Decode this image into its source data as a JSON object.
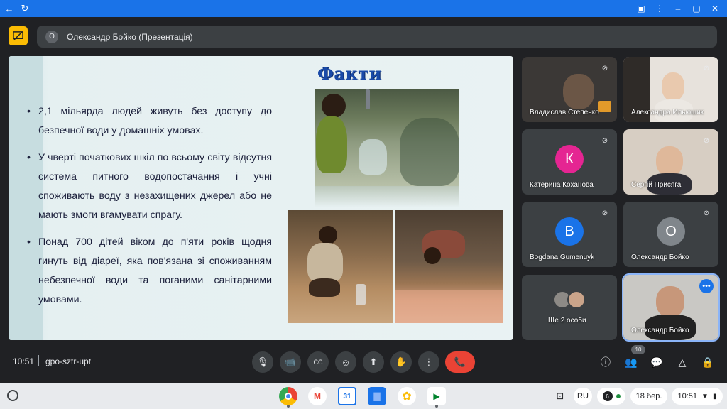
{
  "browser": {
    "back_icon": "←",
    "reload_icon": "↻",
    "right_icons": [
      "▣",
      "⋮",
      "–",
      "▢",
      "✕"
    ]
  },
  "presenter": {
    "avatar_letter": "О",
    "name": "Олександр Бойко (Презентація)"
  },
  "slide": {
    "title": "Факти",
    "bullets": [
      "2,1 мільярда людей живуть без доступу до безпечної води у домашніх умовах.",
      "У чверті початкових шкіл по всьому світу відсутня система питного водопостачання і учні споживають воду з незахищених джерел або не мають змоги вгамувати спрагу.",
      "Понад 700 дітей віком до п'яти років щодня гинуть від діареї, яка пов'язана зі споживанням небезпечної води та поганими санітарними умовами."
    ]
  },
  "participants": [
    {
      "name": "Владислав Степенко"
    },
    {
      "name": "Александра Ильюшик"
    },
    {
      "name": "Катерина Коханова",
      "letter": "К",
      "color": "#e52592"
    },
    {
      "name": "Сергій Присяга"
    },
    {
      "name": "Bogdana Gumenuyk",
      "letter": "B",
      "color": "#1a73e8"
    },
    {
      "name": "Олександр Бойко",
      "letter": "О",
      "color": "#80868b"
    },
    {
      "name": "Ще 2 особи"
    },
    {
      "name": "Олександр Бойко"
    }
  ],
  "meeting": {
    "time": "10:51",
    "code": "gpo-sztr-upt",
    "participant_count": "10"
  },
  "controls": {
    "mic": "🎙",
    "camera": "📹",
    "captions": "CC",
    "emoji": "☺",
    "present": "⬆",
    "hand": "✋",
    "more": "⋮",
    "end": "📞",
    "info": "ⓘ",
    "people": "👥",
    "chat": "💬",
    "activities": "△",
    "host": "🔒"
  },
  "shelf": {
    "lang": "RU",
    "notifications": "6",
    "date": "18 бер.",
    "clock": "10:51",
    "apps": [
      {
        "name": "chrome",
        "label": "◉",
        "color": "#ea4335"
      },
      {
        "name": "gmail",
        "label": "M",
        "color": "#ea4335"
      },
      {
        "name": "calendar",
        "label": "31",
        "color": "#1a73e8"
      },
      {
        "name": "files",
        "label": "▇",
        "color": "#1a73e8"
      },
      {
        "name": "photos",
        "label": "✿",
        "color": "#fbbc04"
      },
      {
        "name": "meet",
        "label": "▶",
        "color": "#00832d"
      }
    ]
  }
}
